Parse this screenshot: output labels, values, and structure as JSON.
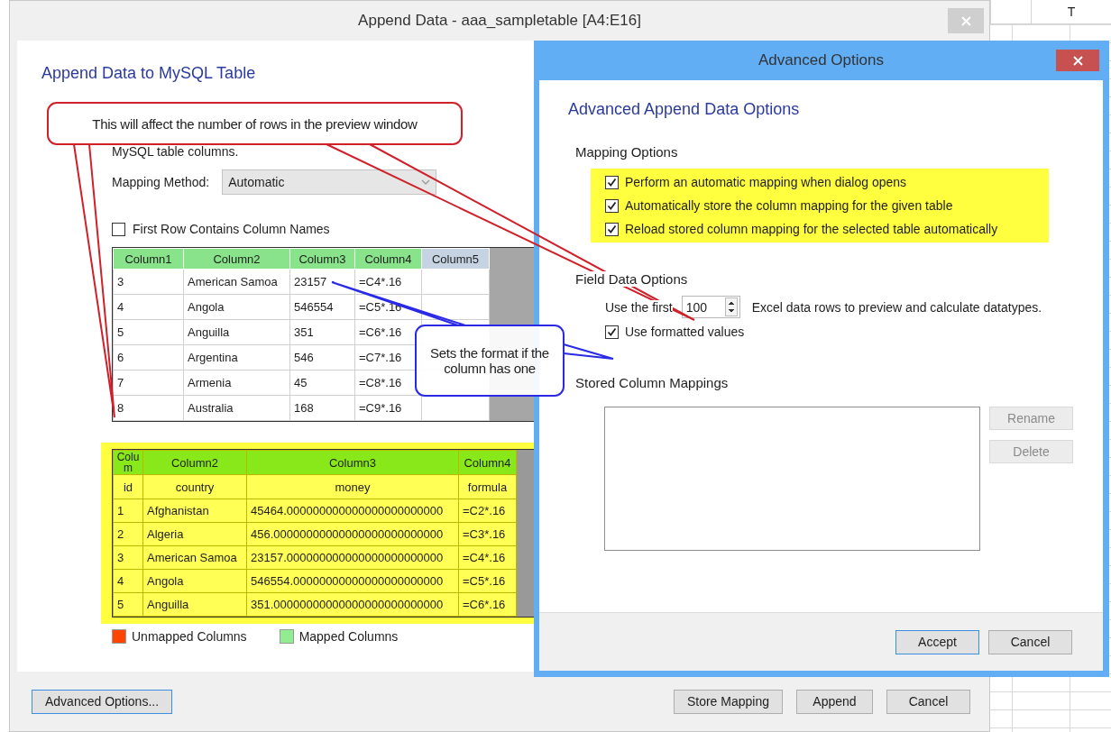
{
  "main_window": {
    "title": "Append Data - aaa_sampletable [A4:E16]",
    "heading": "Append Data to MySQL Table",
    "description": "MySQL table columns.",
    "mapping_method": {
      "label": "Mapping Method:",
      "value": "Automatic"
    },
    "first_row_checkbox": {
      "label": "First Row Contains Column Names",
      "checked": false
    },
    "source_table": {
      "columns": [
        {
          "label": "Column1",
          "mapped": true
        },
        {
          "label": "Column2",
          "mapped": true
        },
        {
          "label": "Column3",
          "mapped": true
        },
        {
          "label": "Column4",
          "mapped": true
        },
        {
          "label": "Column5",
          "mapped": false
        }
      ],
      "rows": [
        [
          "3",
          "American Samoa",
          "23157",
          "=C4*.16",
          ""
        ],
        [
          "4",
          "Angola",
          "546554",
          "=C5*.16",
          ""
        ],
        [
          "5",
          "Anguilla",
          "351",
          "=C6*.16",
          ""
        ],
        [
          "6",
          "Argentina",
          "546",
          "=C7*.16",
          ""
        ],
        [
          "7",
          "Armenia",
          "45",
          "=C8*.16",
          ""
        ],
        [
          "8",
          "Australia",
          "168",
          "=C9*.16",
          ""
        ]
      ]
    },
    "target_table": {
      "mapped_columns": [
        "Colum",
        "Column2",
        "Column3",
        "Column4"
      ],
      "columns": [
        "id",
        "country",
        "money",
        "formula"
      ],
      "rows": [
        [
          "1",
          "Afghanistan",
          "45464.000000000000000000000000",
          "=C2*.16"
        ],
        [
          "2",
          "Algeria",
          "456.00000000000000000000000000",
          "=C3*.16"
        ],
        [
          "3",
          "American Samoa",
          "23157.000000000000000000000000",
          "=C4*.16"
        ],
        [
          "4",
          "Angola",
          "546554.00000000000000000000000",
          "=C5*.16"
        ],
        [
          "5",
          "Anguilla",
          "351.00000000000000000000000000",
          "=C6*.16"
        ]
      ]
    },
    "legend": [
      {
        "label": "Unmapped Columns",
        "color": "#ff4500"
      },
      {
        "label": "Mapped Columns",
        "color": "#90ee90"
      }
    ],
    "left_buttons": [
      {
        "label": "Advanced Options...",
        "focused": true
      }
    ],
    "right_buttons": [
      {
        "label": "Store Mapping",
        "focused": false
      },
      {
        "label": "Append",
        "focused": false
      },
      {
        "label": "Cancel",
        "focused": false
      }
    ]
  },
  "advanced_window": {
    "title": "Advanced Options",
    "heading": "Advanced Append Data Options",
    "mapping_options": {
      "title": "Mapping Options",
      "items": [
        {
          "label": "Perform an automatic mapping when dialog opens",
          "checked": true
        },
        {
          "label": "Automatically store the column mapping for the given table",
          "checked": true
        },
        {
          "label": "Reload stored column mapping for the selected table automatically",
          "checked": true
        }
      ]
    },
    "field_data_options": {
      "title": "Field Data Options",
      "prefix": "Use the first",
      "value": "100",
      "suffix": "Excel data rows to preview and calculate datatypes.",
      "formatted": {
        "label": "Use formatted values",
        "checked": true
      }
    },
    "stored_mappings": {
      "title": "Stored Column Mappings",
      "buttons": [
        {
          "label": "Rename",
          "disabled": true
        },
        {
          "label": "Delete",
          "disabled": true
        }
      ]
    },
    "buttons": [
      {
        "label": "Accept",
        "focused": true
      },
      {
        "label": "Cancel",
        "focused": false
      }
    ]
  },
  "callouts": [
    {
      "kind": "red",
      "text": "This will affect the number of rows in the preview window"
    },
    {
      "kind": "blue",
      "text": "Sets the format if the column has one"
    }
  ],
  "spreadsheet": {
    "column_header": "T"
  }
}
